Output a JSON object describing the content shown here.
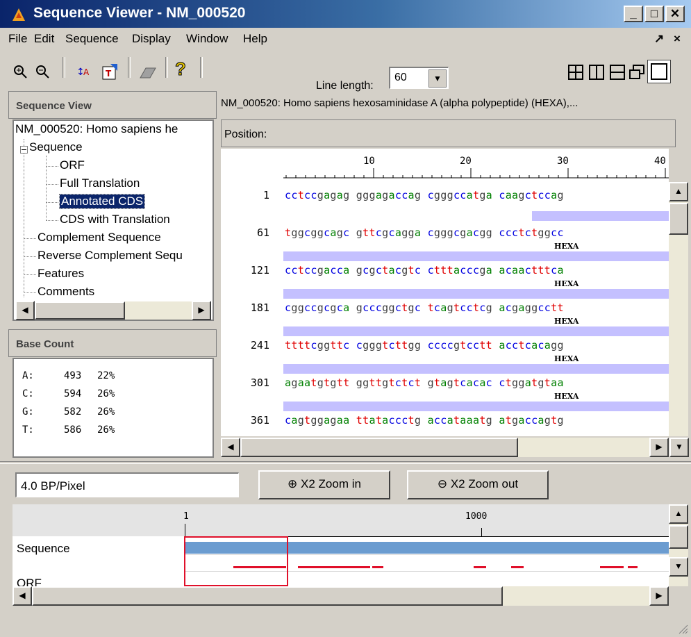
{
  "window": {
    "title": "Sequence Viewer - NM_000520"
  },
  "menu": [
    "File",
    "Edit",
    "Sequence",
    "Display",
    "Window",
    "Help"
  ],
  "menu_right": [
    "↗",
    "×"
  ],
  "toolbar": {
    "zoom_in_icon": "zoom-in-icon",
    "zoom_out_icon": "zoom-out-icon",
    "line_length_label": "Line length:",
    "line_length_value": "60",
    "help_glyph": "?"
  },
  "sequence_view": {
    "header": "Sequence View",
    "root": "NM_000520: Homo sapiens he",
    "sequence_node": "Sequence",
    "children": [
      "ORF",
      "Full Translation",
      "Annotated CDS",
      "CDS with Translation"
    ],
    "selected": "Annotated CDS",
    "top_level": [
      "Complement Sequence",
      "Reverse Complement Sequ",
      "Features",
      "Comments"
    ]
  },
  "base_count": {
    "header": "Base Count",
    "rows": [
      {
        "base": "A:",
        "count": "493",
        "pct": "22%"
      },
      {
        "base": "C:",
        "count": "594",
        "pct": "26%"
      },
      {
        "base": "G:",
        "count": "582",
        "pct": "26%"
      },
      {
        "base": "T:",
        "count": "586",
        "pct": "26%"
      }
    ]
  },
  "viewer": {
    "header": "NM_000520: Homo sapiens hexosaminidase A (alpha polypeptide) (HEXA),...",
    "position_label": "Position:",
    "ruler": [
      "10",
      "20",
      "30",
      "40"
    ],
    "feature_label": "HEXA",
    "lines": [
      {
        "pos": "1",
        "seq": "cctccgagag gggagaccag cgggccatga caagctccag"
      },
      {
        "pos": "61",
        "seq": "tggcggcagc gttcgcagga cgggcgacgg ccctctggcc"
      },
      {
        "pos": "121",
        "seq": "cctccgacca gcgctacgtc ctttacccga acaactttca"
      },
      {
        "pos": "181",
        "seq": "cggccgcgca gcccggctgc tcagtcctcg acgaggcctt"
      },
      {
        "pos": "241",
        "seq": "ttttcggttc cgggtcttgg ccccgtcctt acctcacagg"
      },
      {
        "pos": "301",
        "seq": "agaatgtgtt ggttgtctct gtagtcacac ctggatgtaa"
      },
      {
        "pos": "361",
        "seq": "cagtggagaa ttataccctg accataaatg atgaccagtg"
      }
    ]
  },
  "bottom": {
    "scale": "4.0 BP/Pixel",
    "zoom_in": "X2 Zoom in",
    "zoom_out": "X2 Zoom out",
    "axis_start": "1",
    "axis_mid": "1000",
    "track_sequence": "Sequence",
    "track_orf": "ORF"
  },
  "colors": {
    "a": "#008000",
    "c": "#0000e0",
    "g": "#404040",
    "t": "#e00000",
    "feature": "#c4c0ff",
    "selection": "#0a246a"
  }
}
